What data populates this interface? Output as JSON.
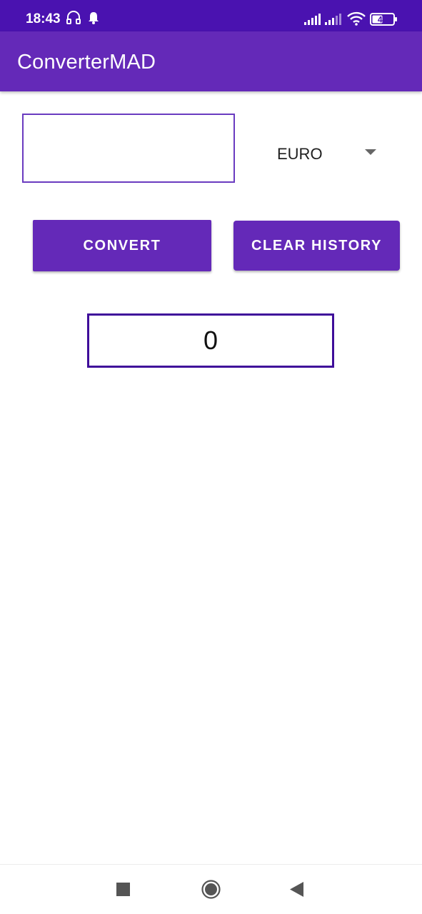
{
  "status_bar": {
    "time": "18:43",
    "battery": "49",
    "icons": [
      "headset-icon",
      "notification-bell-icon",
      "signal-icon",
      "signal-icon",
      "wifi-icon",
      "battery-icon"
    ]
  },
  "app_bar": {
    "title": "ConverterMAD"
  },
  "converter": {
    "amount_value": "",
    "amount_placeholder": "",
    "currency_selected": "EURO",
    "convert_label": "CONVERT",
    "clear_history_label": "CLEAR HISTORY",
    "result": "0"
  },
  "nav_bar": {
    "buttons": [
      "recents-square-icon",
      "home-circle-icon",
      "back-triangle-icon"
    ]
  },
  "colors": {
    "status_bar": "#4a12b0",
    "app_bar": "#6429b8",
    "button": "#6429b8",
    "result_border": "#3f0e9a",
    "input_border": "#6a3bc0"
  }
}
